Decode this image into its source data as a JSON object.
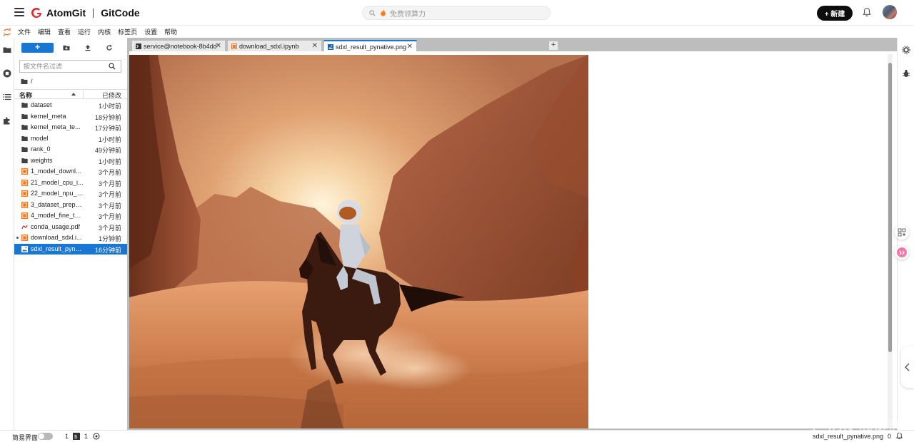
{
  "topbar": {
    "brand_primary": "AtomGit",
    "brand_secondary": "GitCode",
    "search_placeholder": "免费领算力",
    "new_button_label": "+ 新建",
    "brand_color": "#e0282e"
  },
  "menubar": {
    "items": [
      "文件",
      "编辑",
      "查看",
      "运行",
      "内核",
      "标签页",
      "设置",
      "帮助"
    ]
  },
  "filebrowser": {
    "new_button_label": "+",
    "filter_placeholder": "按文件名过滤",
    "breadcrumb": "/",
    "col_name": "名称",
    "col_modified": "已修改",
    "files": [
      {
        "name": "dataset",
        "modified": "1小时前",
        "type": "folder"
      },
      {
        "name": "kernel_meta",
        "modified": "18分钟前",
        "type": "folder"
      },
      {
        "name": "kernel_meta_te...",
        "modified": "17分钟前",
        "type": "folder"
      },
      {
        "name": "model",
        "modified": "1小时前",
        "type": "folder"
      },
      {
        "name": "rank_0",
        "modified": "49分钟前",
        "type": "folder"
      },
      {
        "name": "weights",
        "modified": "1小时前",
        "type": "folder"
      },
      {
        "name": "1_model_downl...",
        "modified": "3个月前",
        "type": "notebook"
      },
      {
        "name": "21_model_cpu_i...",
        "modified": "3个月前",
        "type": "notebook"
      },
      {
        "name": "22_model_npu_i...",
        "modified": "3个月前",
        "type": "notebook"
      },
      {
        "name": "3_dataset_prepa...",
        "modified": "3个月前",
        "type": "notebook"
      },
      {
        "name": "4_model_fine_tu...",
        "modified": "3个月前",
        "type": "notebook"
      },
      {
        "name": "conda_usage.pdf",
        "modified": "3个月前",
        "type": "pdf"
      },
      {
        "name": "download_sdxl.i...",
        "modified": "1分钟前",
        "type": "notebook",
        "running": true
      },
      {
        "name": "sdxl_result_pyna...",
        "modified": "16分钟前",
        "type": "image",
        "selected": true
      }
    ]
  },
  "tabs": [
    {
      "label": "service@notebook-8b4dd:",
      "icon": "terminal-icon",
      "active": false
    },
    {
      "label": "download_sdxl.ipynb",
      "icon": "notebook-icon",
      "active": false
    },
    {
      "label": "sdxl_result_pynative.png",
      "icon": "image-icon",
      "active": true
    }
  ],
  "statusbar": {
    "mode_label": "简易界面",
    "count_a": "1",
    "count_b": "1",
    "right_filename": "sdxl_result_pynative.png",
    "right_count": "0"
  },
  "watermark": "CSDN @凌武"
}
